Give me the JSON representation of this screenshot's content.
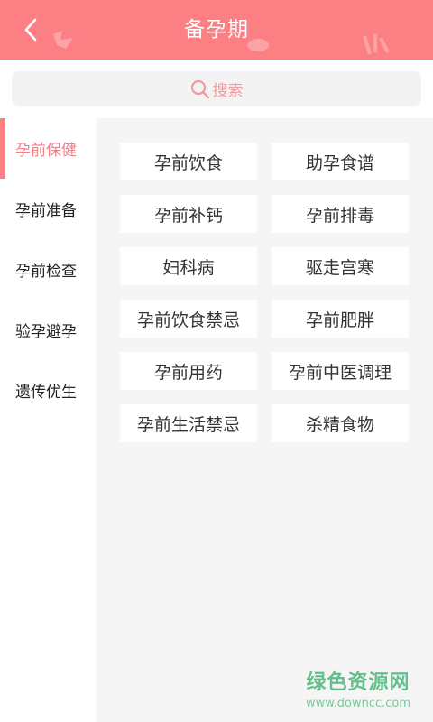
{
  "header": {
    "title": "备孕期",
    "back_icon": "chevron-left-icon",
    "background_color": "#fc7f84"
  },
  "search": {
    "label": "搜索",
    "icon": "search-icon",
    "accent_color": "#f39a9e"
  },
  "sidebar": {
    "items": [
      {
        "label": "孕前保健",
        "active": true
      },
      {
        "label": "孕前准备",
        "active": false
      },
      {
        "label": "孕前检查",
        "active": false
      },
      {
        "label": "验孕避孕",
        "active": false
      },
      {
        "label": "遗传优生",
        "active": false
      }
    ],
    "active_color": "#f37f85"
  },
  "content": {
    "tags": [
      "孕前饮食",
      "助孕食谱",
      "孕前补钙",
      "孕前排毒",
      "妇科病",
      "驱走宫寒",
      "孕前饮食禁忌",
      "孕前肥胖",
      "孕前用药",
      "孕前中医调理",
      "孕前生活禁忌",
      "杀精食物"
    ]
  },
  "watermark": {
    "main": "绿色资源网",
    "sub": "www.downcc.com"
  }
}
